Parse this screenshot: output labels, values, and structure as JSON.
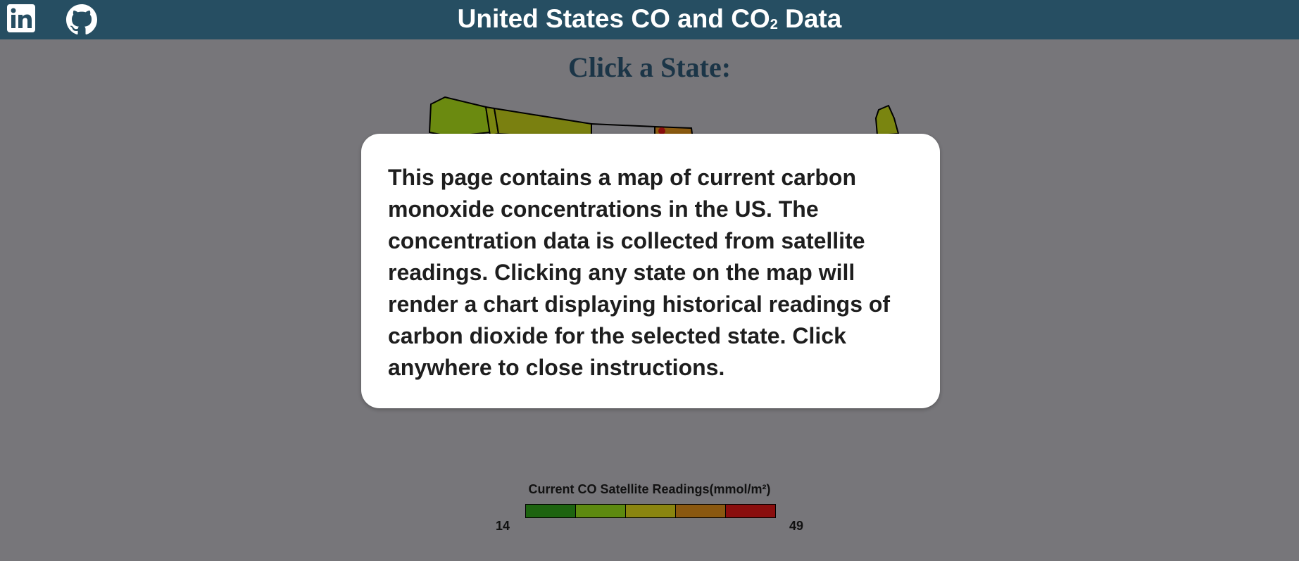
{
  "header": {
    "title": "United States CO and CO",
    "title_subscript": "2",
    "title_suffix": " Data",
    "linkedin_icon": "linkedin-icon",
    "github_icon": "github-icon"
  },
  "page": {
    "subtitle": "Click a State:"
  },
  "modal": {
    "text": "This page contains a map of current carbon monoxide concentrations in the US. The concentration data is collected from satellite readings. Clicking any state on the map will render a chart displaying historical readings of carbon dioxide for the selected state. Click anywhere to close instructions."
  },
  "legend": {
    "title": "Current CO Satellite Readings(mmol/m²)",
    "min": "14",
    "max": "49",
    "colors": [
      "#1d6410",
      "#5d8a10",
      "#8a8510",
      "#8a5810",
      "#8a0e0e"
    ]
  },
  "colors": {
    "header_bg": "#264e62",
    "page_bg": "#77767a",
    "subtitle": "#1b3547"
  }
}
